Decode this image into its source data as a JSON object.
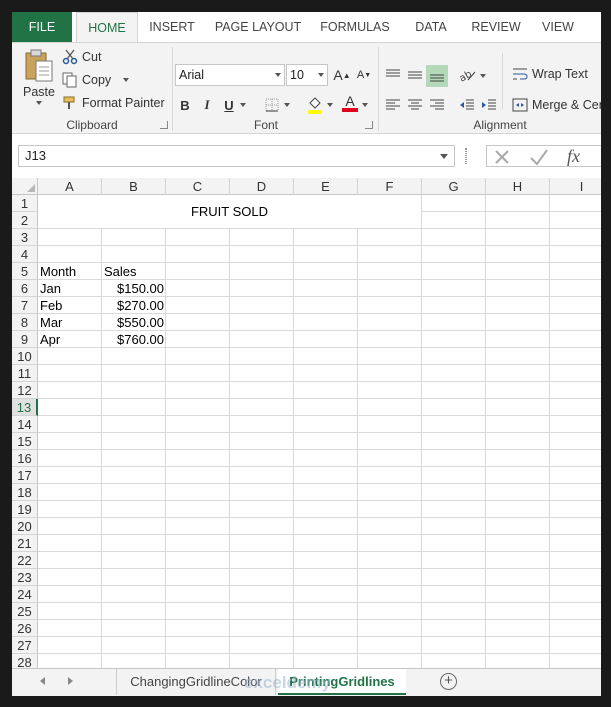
{
  "ribbon_tabs": [
    "FILE",
    "HOME",
    "INSERT",
    "PAGE LAYOUT",
    "FORMULAS",
    "DATA",
    "REVIEW",
    "VIEW"
  ],
  "clipboard": {
    "paste": "Paste",
    "cut": "Cut",
    "copy": "Copy",
    "format_painter": "Format Painter",
    "label": "Clipboard"
  },
  "font": {
    "name": "Arial",
    "size": "10",
    "grow": "A",
    "shrink": "A",
    "bold": "B",
    "italic": "I",
    "underline": "U",
    "font_color_glyph": "A",
    "label": "Font"
  },
  "alignment": {
    "wrap_text": "Wrap Text",
    "merge": "Merge & Center",
    "label": "Alignment"
  },
  "formula_bar": {
    "name_box": "J13",
    "fx": "fx"
  },
  "columns": [
    "A",
    "B",
    "C",
    "D",
    "E",
    "F",
    "G",
    "H",
    "I"
  ],
  "rows": [
    "1",
    "2",
    "3",
    "4",
    "5",
    "6",
    "7",
    "8",
    "9",
    "10",
    "11",
    "12",
    "13",
    "14",
    "15",
    "16",
    "17",
    "18",
    "19",
    "20",
    "21",
    "22",
    "23",
    "24",
    "25",
    "26",
    "27",
    "28"
  ],
  "selected_row": "13",
  "sheet": {
    "title": "FRUIT SOLD",
    "header_month": "Month",
    "header_sales": "Sales",
    "data": [
      {
        "month": "Jan",
        "sales": "$150.00"
      },
      {
        "month": "Feb",
        "sales": "$270.00"
      },
      {
        "month": "Mar",
        "sales": "$550.00"
      },
      {
        "month": "Apr",
        "sales": "$760.00"
      }
    ]
  },
  "sheet_tabs": [
    "ChangingGridlineColor",
    "PrintingGridlines"
  ],
  "active_sheet": "PrintingGridlines",
  "watermark": "exceldemy",
  "colors": {
    "accent": "#217346"
  }
}
